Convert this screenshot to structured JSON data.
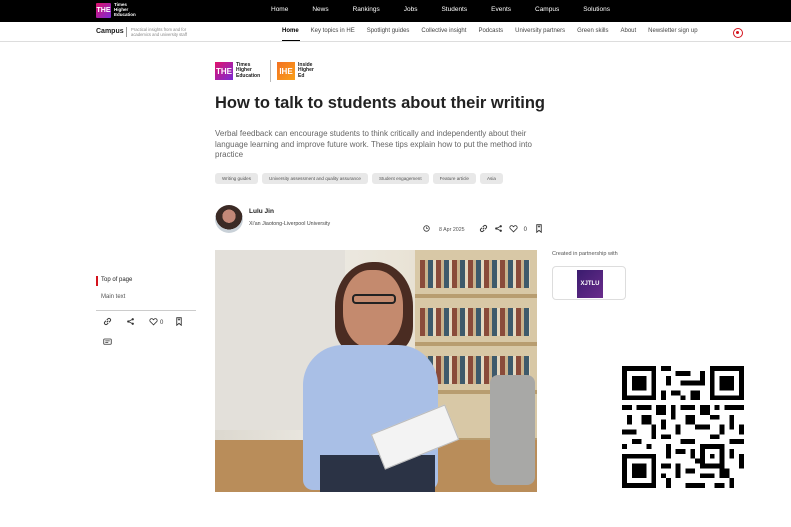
{
  "topbar": {
    "logo_square": "THE",
    "logo_words": "Times Higher Education",
    "nav": [
      "Home",
      "News",
      "Rankings",
      "Jobs",
      "Students",
      "Events",
      "Campus",
      "Solutions"
    ]
  },
  "subbar": {
    "section": "Campus",
    "tagline": "Practical insights from and for academics and university staff",
    "nav": [
      "Home",
      "Key topics in HE",
      "Spotlight guides",
      "Collective insight",
      "Podcasts",
      "University partners",
      "Green skills",
      "About",
      "Newsletter sign up"
    ],
    "active": "Home",
    "user_icon": "user-icon",
    "accent_color": "#d4131d"
  },
  "brand": {
    "the_square": "THE",
    "the_text": "Times Higher Education",
    "ihe_square": "IHE",
    "ihe_text": "Inside Higher Ed"
  },
  "article": {
    "title": "How to talk to students about their writing",
    "standfirst": "Verbal feedback can encourage students to think critically and independently about their language learning and improve future work. These tips explain how to put the method into practice",
    "tags": [
      "Writing guides",
      "University assessment and quality assurance",
      "Student engagement",
      "Feature article",
      "Asia"
    ],
    "author_name": "Lulu Jin",
    "author_institution": "Xi'an Jiaotong-Liverpool University",
    "date": "8 Apr 2025",
    "like_count": "0"
  },
  "rail": {
    "top_of_page": "Top of page",
    "main_text": "Main text",
    "like_count": "0"
  },
  "partner": {
    "label": "Created in partnership with",
    "logo_text": "XJTLU"
  }
}
